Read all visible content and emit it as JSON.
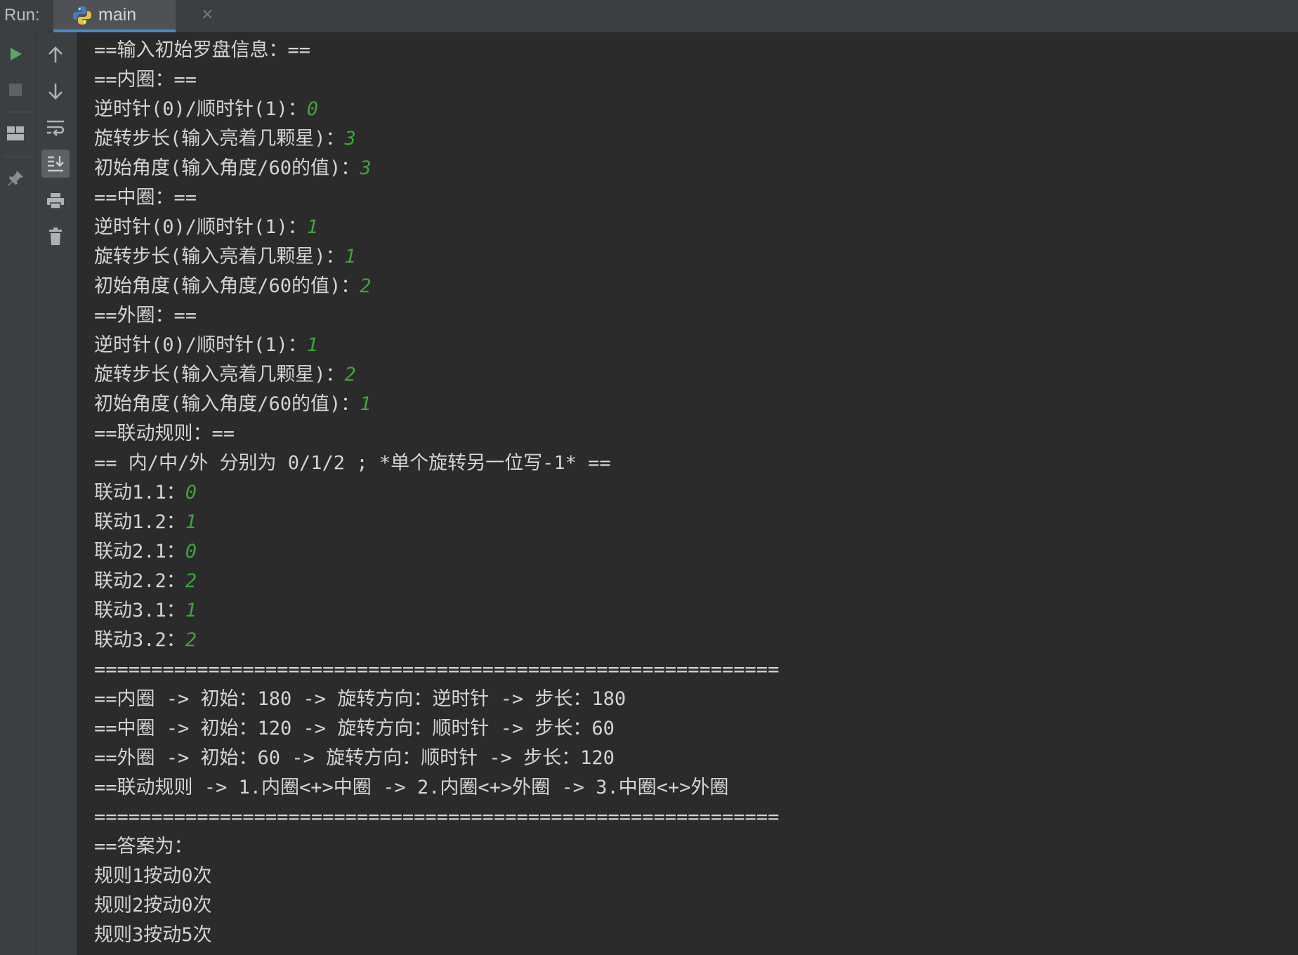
{
  "run_bar": {
    "run_label": "Run:",
    "tab_title": "main",
    "tab_close": "×"
  },
  "toolbar_left": {
    "icons": [
      "play-icon",
      "stop-icon",
      "layout-icon",
      "pin-icon"
    ]
  },
  "toolbar_right": {
    "icons": [
      "arrow-up-icon",
      "arrow-down-icon",
      "soft-wrap-icon",
      "scroll-to-end-icon",
      "print-icon",
      "trash-icon"
    ]
  },
  "colors": {
    "input_value": "#3fa33b",
    "console_text": "#d4d4d4",
    "tab_underline": "#4a88c7"
  },
  "console": {
    "lines": [
      {
        "text": "==输入初始罗盘信息：==",
        "input": ""
      },
      {
        "text": "==内圈：==",
        "input": ""
      },
      {
        "text": "逆时针(0)/顺时针(1)：",
        "input": "0"
      },
      {
        "text": "旋转步长(输入亮着几颗星)：",
        "input": "3"
      },
      {
        "text": "初始角度(输入角度/60的值)：",
        "input": "3"
      },
      {
        "text": "==中圈：==",
        "input": ""
      },
      {
        "text": "逆时针(0)/顺时针(1)：",
        "input": "1"
      },
      {
        "text": "旋转步长(输入亮着几颗星)：",
        "input": "1"
      },
      {
        "text": "初始角度(输入角度/60的值)：",
        "input": "2"
      },
      {
        "text": "==外圈：==",
        "input": ""
      },
      {
        "text": "逆时针(0)/顺时针(1)：",
        "input": "1"
      },
      {
        "text": "旋转步长(输入亮着几颗星)：",
        "input": "2"
      },
      {
        "text": "初始角度(输入角度/60的值)：",
        "input": "1"
      },
      {
        "text": "==联动规则：==",
        "input": ""
      },
      {
        "text": "== 内/中/外 分别为 0/1/2 ; *单个旋转另一位写-1* ==",
        "input": ""
      },
      {
        "text": "联动1.1：",
        "input": "0"
      },
      {
        "text": "联动1.2：",
        "input": "1"
      },
      {
        "text": "联动2.1：",
        "input": "0"
      },
      {
        "text": "联动2.2：",
        "input": "2"
      },
      {
        "text": "联动3.1：",
        "input": "1"
      },
      {
        "text": "联动3.2：",
        "input": "2"
      },
      {
        "text": "============================================================",
        "input": ""
      },
      {
        "text": "==内圈 -> 初始：180 -> 旋转方向：逆时针 -> 步长：180",
        "input": ""
      },
      {
        "text": "==中圈 -> 初始：120 -> 旋转方向：顺时针 -> 步长：60",
        "input": ""
      },
      {
        "text": "==外圈 -> 初始：60 -> 旋转方向：顺时针 -> 步长：120",
        "input": ""
      },
      {
        "text": "==联动规则 -> 1.内圈<+>中圈 -> 2.内圈<+>外圈 -> 3.中圈<+>外圈",
        "input": ""
      },
      {
        "text": "============================================================",
        "input": ""
      },
      {
        "text": "==答案为：",
        "input": ""
      },
      {
        "text": "规则1按动0次",
        "input": ""
      },
      {
        "text": "规则2按动0次",
        "input": ""
      },
      {
        "text": "规则3按动5次",
        "input": ""
      }
    ]
  }
}
